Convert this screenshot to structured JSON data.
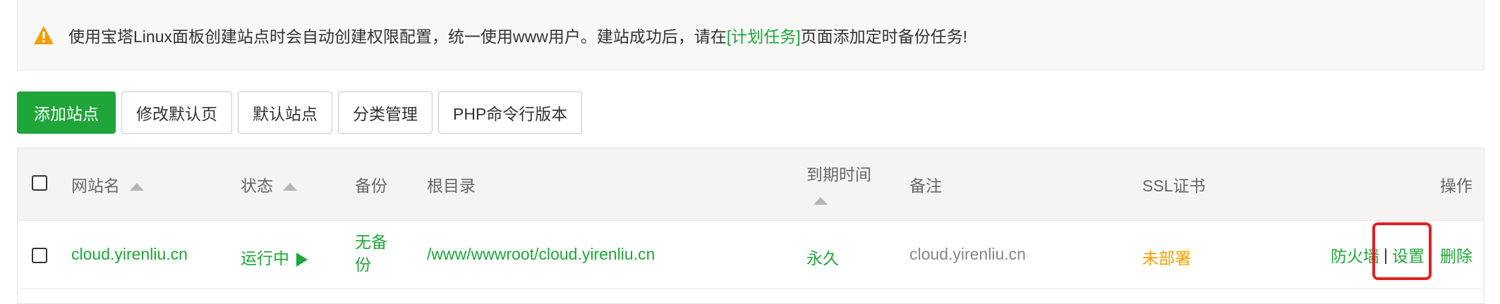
{
  "notice": {
    "text_before": "使用宝塔Linux面板创建站点时会自动创建权限配置，统一使用www用户。建站成功后，请在",
    "link": "[计划任务]",
    "text_after": "页面添加定时备份任务!",
    "icon": "warning-triangle-icon",
    "icon_color": "#f0a000"
  },
  "toolbar": {
    "add_site": "添加站点",
    "edit_default_page": "修改默认页",
    "default_site": "默认站点",
    "category_manage": "分类管理",
    "php_cli_version": "PHP命令行版本"
  },
  "table": {
    "headers": {
      "name": "网站名",
      "status": "状态",
      "backup": "备份",
      "root": "根目录",
      "expire_line1": "到期时间",
      "note": "备注",
      "ssl": "SSL证书",
      "actions": "操作"
    },
    "rows": [
      {
        "name": "cloud.yirenliu.cn",
        "status": "运行中",
        "backup_line1": "无备",
        "backup_line2": "份",
        "root": "/www/wwwroot/cloud.yirenliu.cn",
        "expire": "永久",
        "note": "cloud.yirenliu.cn",
        "ssl": "未部署",
        "actions": {
          "firewall": "防火墙",
          "separator": "|",
          "settings": "设置",
          "delete": "删除"
        }
      }
    ]
  },
  "colors": {
    "brand_green": "#20a53a",
    "ssl_warning": "#f0a000",
    "highlight_red": "#e02020"
  }
}
